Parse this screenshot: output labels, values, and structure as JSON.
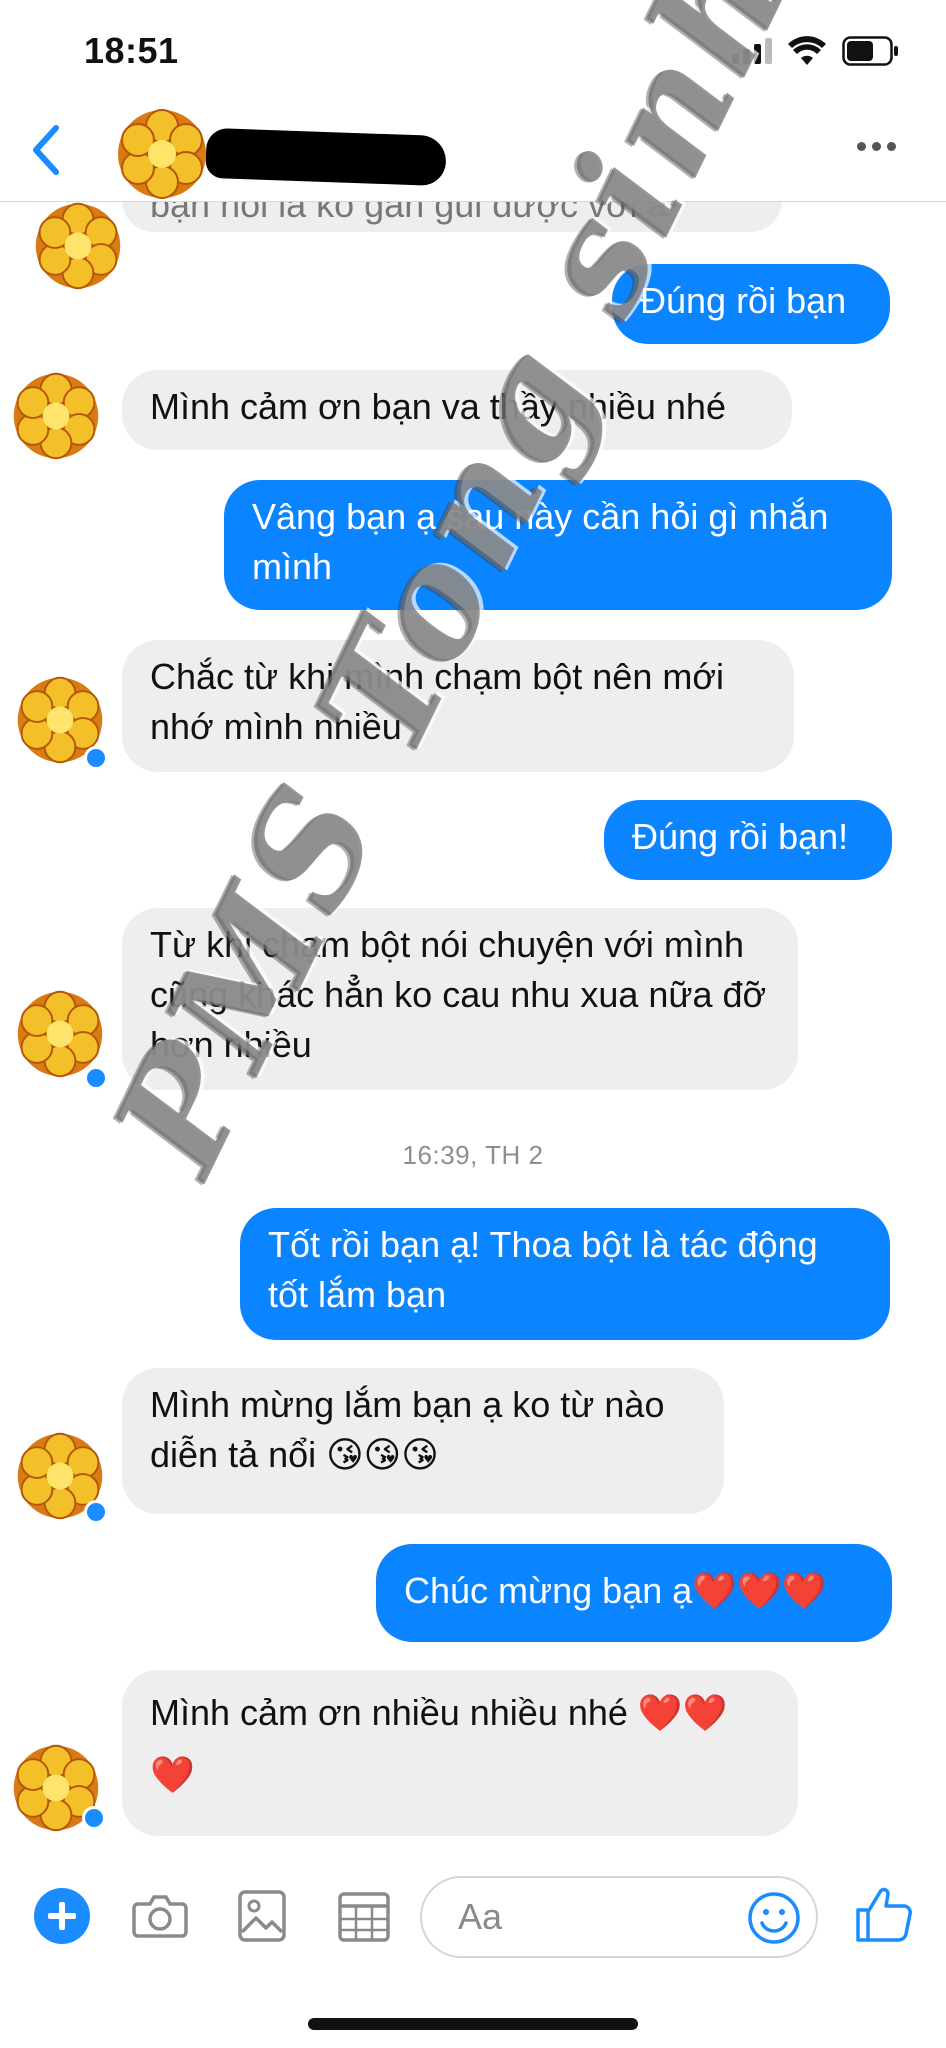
{
  "status_bar": {
    "time": "18:51"
  },
  "header": {
    "contact_name": ""
  },
  "messages": [
    {
      "side": "in",
      "text": "bạn nói là ko gần gũi được với a"
    },
    {
      "side": "out",
      "text": "Đúng rồi bạn"
    },
    {
      "side": "in",
      "text": "Mình cảm ơn bạn va thầy nhiều nhé"
    },
    {
      "side": "out",
      "text": "Vâng bạn ạ sau này cần hỏi gì nhắn mình"
    },
    {
      "side": "in",
      "text": "Chắc từ khi mình chạm bột nên mới nhớ mình nhiều"
    },
    {
      "side": "out",
      "text": "Đúng rồi bạn!"
    },
    {
      "side": "in",
      "text": "Từ khi chạm bột nói chuyện với mình cũng khác hẳn ko cau nhu xua nữa đỡ hơn nhiều"
    },
    {
      "side": "out",
      "text": "Tốt rồi bạn ạ! Thoa bột là tác động tốt lắm bạn"
    },
    {
      "side": "in",
      "text": "Mình mừng lắm bạn ạ ko từ nào diễn tả nổi 😘😘😘"
    },
    {
      "side": "out",
      "text": "Chúc mừng bạn ạ❤️❤️❤️"
    },
    {
      "side": "in",
      "text": "Mình cảm ơn nhiều nhiều nhé ❤️❤️ ❤️"
    }
  ],
  "timestamp": "16:39, TH 2",
  "composer": {
    "placeholder": "Aa"
  },
  "watermark": "PMS Tong sinh",
  "colors": {
    "accent": "#0a84ff",
    "incoming_bubble": "#eeeeee",
    "outgoing_text": "#ffffff"
  },
  "icons": [
    "back-icon",
    "more-icon",
    "plus-icon",
    "camera-icon",
    "image-icon",
    "sticker-icon",
    "emoji-icon",
    "like-icon"
  ]
}
